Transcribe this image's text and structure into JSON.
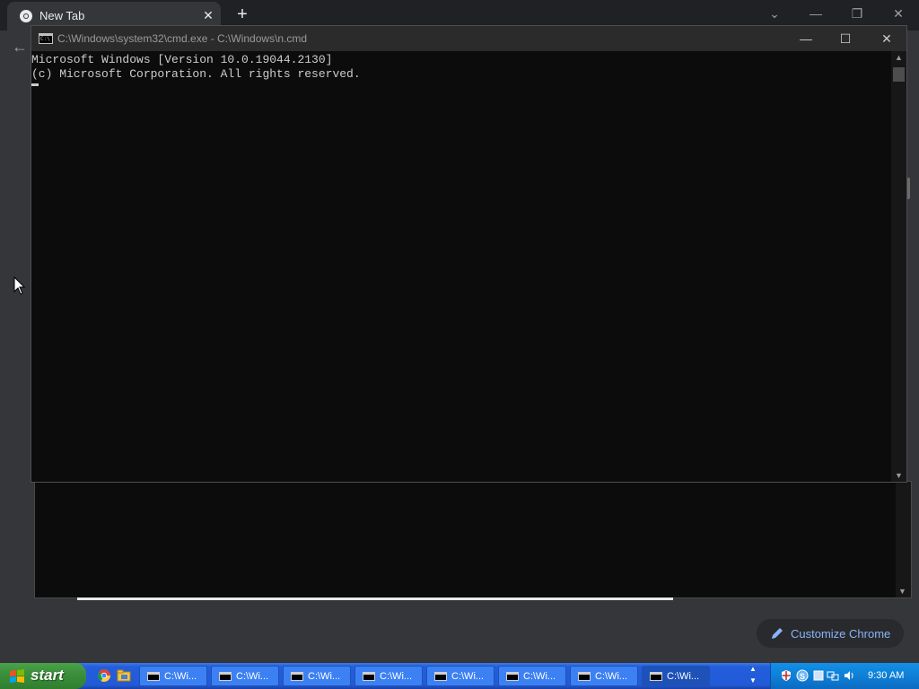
{
  "browser": {
    "tab_title": "New Tab",
    "tab_close": "✕",
    "new_tab": "+",
    "controls": {
      "dropdown": "⌄",
      "minimize": "—",
      "restore": "❐",
      "close": "✕"
    },
    "back": "←",
    "customize_label": "Customize Chrome",
    "accent_color": "#8ab4f8"
  },
  "cmd": {
    "title": "C:\\Windows\\system32\\cmd.exe - C:\\Windows\\n.cmd",
    "controls": {
      "minimize": "—",
      "maximize": "☐",
      "close": "✕"
    },
    "lines": [
      "Microsoft Windows [Version 10.0.19044.2130]",
      "(c) Microsoft Corporation. All rights reserved."
    ]
  },
  "taskbar": {
    "start_label": "start",
    "task_buttons": [
      "C:\\Wi...",
      "C:\\Wi...",
      "C:\\Wi...",
      "C:\\Wi...",
      "C:\\Wi...",
      "C:\\Wi...",
      "C:\\Wi...",
      "C:\\Wi..."
    ],
    "clock": "9:30 AM"
  }
}
